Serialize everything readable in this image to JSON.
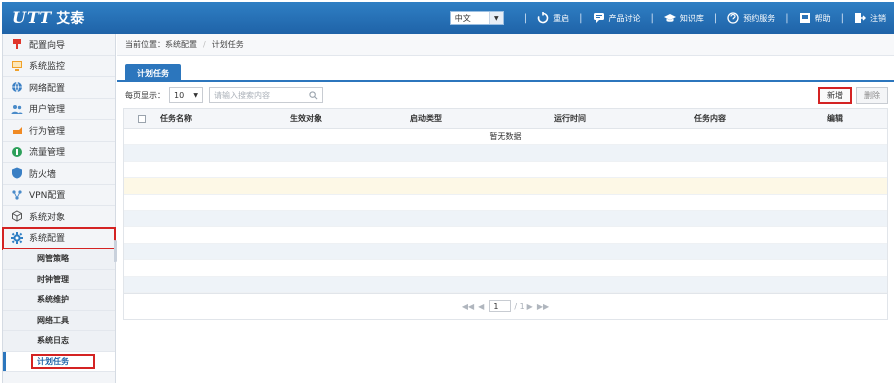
{
  "header": {
    "logo_mark": "UTT",
    "logo_text": "艾泰",
    "language": "中文",
    "items": [
      {
        "label": "重启",
        "icon": "restart-icon"
      },
      {
        "label": "产品讨论",
        "icon": "chat-icon"
      },
      {
        "label": "知识库",
        "icon": "knowledge-icon"
      },
      {
        "label": "预约服务",
        "icon": "service-icon"
      },
      {
        "label": "帮助",
        "icon": "help-icon"
      },
      {
        "label": "注销",
        "icon": "logout-icon"
      }
    ]
  },
  "sidebar": {
    "items": [
      {
        "label": "配置向导",
        "icon": "wizard-icon"
      },
      {
        "label": "系统监控",
        "icon": "monitor-icon"
      },
      {
        "label": "网络配置",
        "icon": "network-icon"
      },
      {
        "label": "用户管理",
        "icon": "users-icon"
      },
      {
        "label": "行为管理",
        "icon": "behavior-icon"
      },
      {
        "label": "流量管理",
        "icon": "traffic-icon"
      },
      {
        "label": "防火墙",
        "icon": "firewall-icon"
      },
      {
        "label": "VPN配置",
        "icon": "vpn-icon"
      },
      {
        "label": "系统对象",
        "icon": "object-icon"
      },
      {
        "label": "系统配置",
        "icon": "gear-icon"
      }
    ],
    "sub_items": [
      {
        "label": "网管策略"
      },
      {
        "label": "时钟管理"
      },
      {
        "label": "系统维护"
      },
      {
        "label": "网络工具"
      },
      {
        "label": "系统日志"
      },
      {
        "label": "计划任务"
      }
    ]
  },
  "breadcrumb": {
    "prefix": "当前位置：",
    "parent": "系统配置",
    "separator": "/",
    "current": "计划任务"
  },
  "tab": {
    "label": "计划任务"
  },
  "toolbar": {
    "per_page_label": "每页显示：",
    "per_page_value": "10",
    "search_placeholder": "请输入搜索内容",
    "new_label": "新增",
    "delete_label": "删除"
  },
  "table": {
    "columns": [
      "任务名称",
      "生效对象",
      "启动类型",
      "运行时间",
      "任务内容",
      "编辑"
    ],
    "empty_text": "暂无数据"
  },
  "pager": {
    "page": "1",
    "total": "/ 1"
  },
  "colors": {
    "header_blue": "#2c76bd",
    "highlight_red": "#d42323"
  }
}
